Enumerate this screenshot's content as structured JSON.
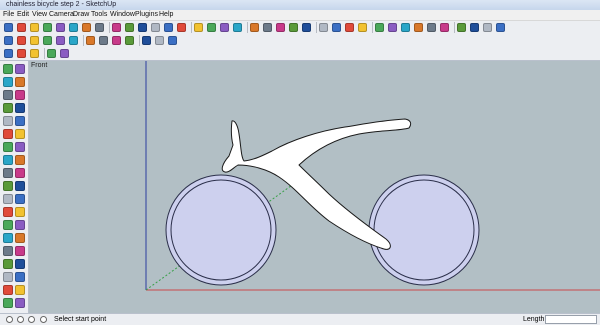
{
  "window": {
    "title": "chainless bicycle step 2 - SketchUp"
  },
  "menu": [
    "File",
    "Edit",
    "View",
    "Camera",
    "Draw",
    "Tools",
    "Window",
    "Plugins",
    "Help"
  ],
  "viewport": {
    "scene_label": "Front"
  },
  "status": {
    "message": "Select start point",
    "length_label": "Length",
    "length_value": ""
  },
  "colors": {
    "viewport_bg": "#b2bfc5",
    "wheel_fill": "#cdd0ee",
    "wheel_stroke": "#2b2f4a",
    "frame_fill": "#ffffff",
    "axis_red": "#c94a4a",
    "axis_green": "#3aa04a",
    "axis_blue": "#2c3e9e"
  },
  "toolbars": {
    "row1": [
      "select-icon",
      "eraser-icon",
      "pencil-icon",
      "rectangle-icon",
      "circle-icon",
      "arc-icon",
      "paint-bucket-icon",
      "make-component-icon",
      "push-pull-icon",
      "follow-me-icon",
      "move-icon",
      "rotate-icon",
      "offset-icon",
      "scale-icon",
      "tape-measure-icon",
      "dimension-icon",
      "protractor-icon",
      "text-icon",
      "axes-icon",
      "3d-text-icon",
      "orbit-icon",
      "pan-icon",
      "zoom-icon",
      "zoom-window-icon",
      "zoom-extents-icon",
      "previous-view-icon",
      "next-view-icon",
      "iso-view-icon",
      "top-view-icon",
      "front-view-icon",
      "right-view-icon",
      "back-view-icon",
      "left-view-icon",
      "get-models-icon",
      "share-model-icon",
      "share-component-icon",
      "layers-icon"
    ],
    "row2": [
      "x-ray-icon",
      "wireframe-icon",
      "hidden-line-icon",
      "shaded-icon",
      "shaded-textures-icon",
      "monochrome-icon",
      "section-plane-icon",
      "shadows-icon",
      "fog-icon",
      "edge-style-icon",
      "sandbox-icon",
      "warehouse-icon",
      "photo-match-icon"
    ],
    "row3": [
      "walk-icon",
      "look-around-icon",
      "position-camera-icon",
      "select-side-icon",
      "paint-side-icon"
    ]
  },
  "side_tools": [
    "select-icon",
    "eraser-icon",
    "rectangle-icon",
    "line-icon",
    "circle-icon",
    "arc-icon",
    "polygon-icon",
    "freehand-icon",
    "move-icon",
    "push-pull-icon",
    "rotate-icon",
    "follow-me-icon",
    "scale-icon",
    "offset-icon",
    "tape-measure-icon",
    "dimension-icon",
    "protractor-icon",
    "text-icon",
    "axes-icon",
    "3d-text-icon",
    "orbit-icon",
    "pan-icon",
    "zoom-icon",
    "zoom-window-icon",
    "previous-icon",
    "zoom-extents-icon",
    "position-camera-icon",
    "walk-icon",
    "look-around-icon",
    "section-plane-icon",
    "paint-bucket-icon",
    "make-component-icon",
    "sandbox-icon",
    "photo-match-icon",
    "get-models-icon",
    "layers-icon",
    "scenes-icon",
    "fog-icon"
  ]
}
